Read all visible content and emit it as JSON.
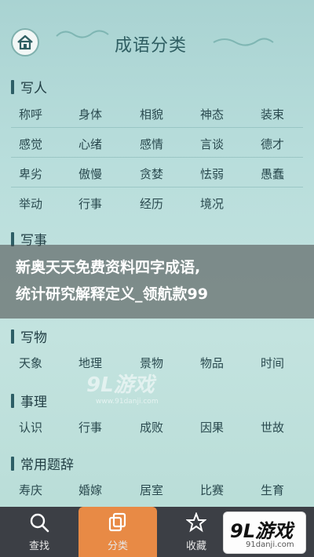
{
  "header": {
    "title": "成语分类",
    "home_icon": "home-icon"
  },
  "sections": [
    {
      "title": "写人",
      "words": [
        "称呼",
        "身体",
        "相貌",
        "神态",
        "装束",
        "感觉",
        "心绪",
        "感情",
        "言谈",
        "德才",
        "卑劣",
        "傲慢",
        "贪婪",
        "怯弱",
        "愚蠢",
        "举动",
        "行事",
        "经历",
        "境况"
      ]
    },
    {
      "title": "写事",
      "words": []
    },
    {
      "title": "写物",
      "words": [
        "天象",
        "地理",
        "景物",
        "物品",
        "时间"
      ]
    },
    {
      "title": "事理",
      "words": [
        "认识",
        "行事",
        "成败",
        "因果",
        "世故"
      ]
    },
    {
      "title": "常用题辞",
      "words": [
        "寿庆",
        "婚嫁",
        "居室",
        "比赛",
        "生育"
      ]
    }
  ],
  "banner": {
    "line1": "新奥天天免费资料四字成语,",
    "line2": "统计研究解释定义_领航款99"
  },
  "watermark": {
    "main": "9L游戏",
    "sub": "www.91danji.com"
  },
  "tabbar": {
    "tabs": [
      {
        "label": "查找",
        "icon": "search-icon"
      },
      {
        "label": "分类",
        "icon": "category-icon"
      },
      {
        "label": "收藏",
        "icon": "star-icon"
      }
    ]
  },
  "logo": {
    "main": "9L游戏",
    "sub": "91danji.com"
  },
  "colors": {
    "active_tab": "#e88a45",
    "tabbar": "#3c3f45",
    "background": "#b9dedc"
  }
}
